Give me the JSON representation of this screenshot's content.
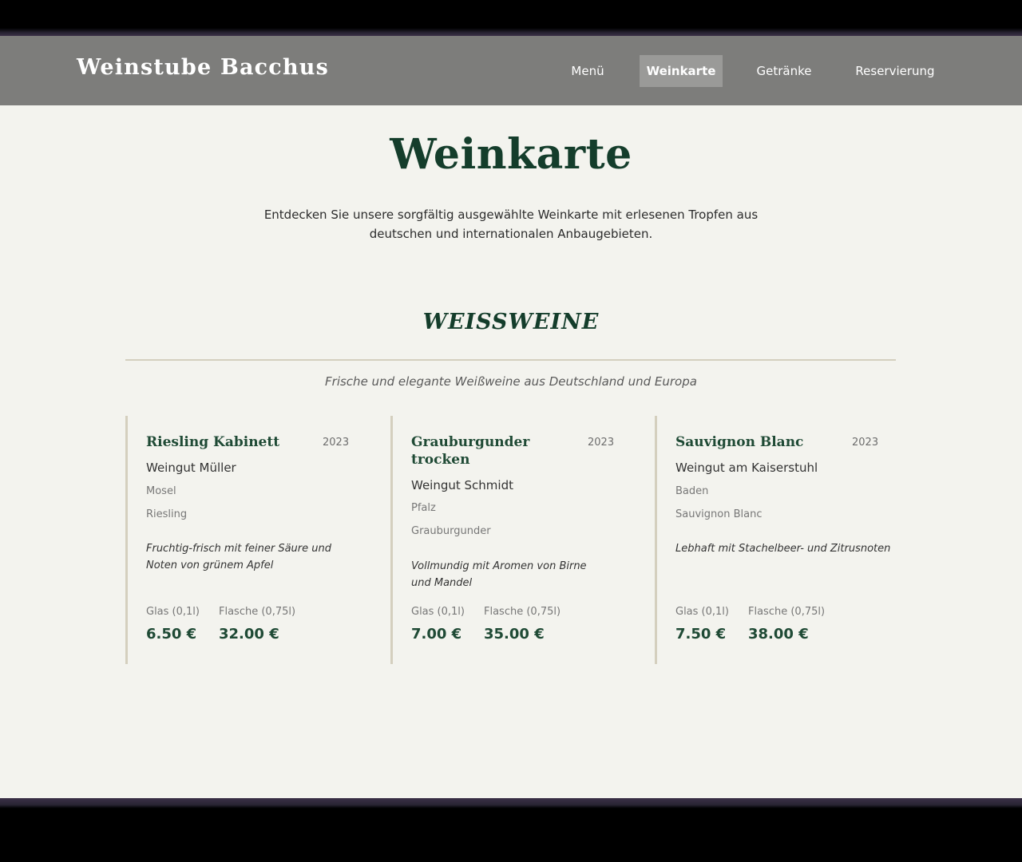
{
  "header": {
    "brand": "Weinstube Bacchus",
    "nav": [
      {
        "label": "Menü"
      },
      {
        "label": "Weinkarte"
      },
      {
        "label": "Getränke"
      },
      {
        "label": "Reservierung"
      }
    ],
    "active_nav": "Weinkarte"
  },
  "page": {
    "title": "Weinkarte",
    "intro": "Entdecken Sie unsere sorgfältig ausgewählte Weinkarte mit erlesenen Tropfen aus deutschen und internationalen Anbaugebieten."
  },
  "section": {
    "title": "WEISSWEINE",
    "subtitle": "Frische und elegante Weißweine aus Deutschland und Europa"
  },
  "wines": [
    {
      "name": "Riesling Kabinett",
      "year": "2023",
      "winery": "Weingut Müller",
      "region": "Mosel",
      "grape": "Riesling",
      "description": "Fruchtig-frisch mit feiner Säure und Noten von grünem Apfel",
      "glass_label": "Glas (0,1l)",
      "bottle_label": "Flasche (0,75l)",
      "glass_price": "6.50 €",
      "bottle_price": "32.00 €"
    },
    {
      "name": "Grauburgunder trocken",
      "year": "2023",
      "winery": "Weingut Schmidt",
      "region": "Pfalz",
      "grape": "Grauburgunder",
      "description": "Vollmundig mit Aromen von Birne und Mandel",
      "glass_label": "Glas (0,1l)",
      "bottle_label": "Flasche (0,75l)",
      "glass_price": "7.00 €",
      "bottle_price": "35.00 €"
    },
    {
      "name": "Sauvignon Blanc",
      "year": "2023",
      "winery": "Weingut am Kaiserstuhl",
      "region": "Baden",
      "grape": "Sauvignon Blanc",
      "description": "Lebhaft mit Stachelbeer- und Zitrusnoten",
      "glass_label": "Glas (0,1l)",
      "bottle_label": "Flasche (0,75l)",
      "glass_price": "7.50 €",
      "bottle_price": "38.00 €"
    }
  ],
  "colors": {
    "header_bg": "#7d7d7b",
    "page_bg": "#f3f3ee",
    "accent_green": "#143d2b",
    "divider": "#d4cfbe"
  }
}
